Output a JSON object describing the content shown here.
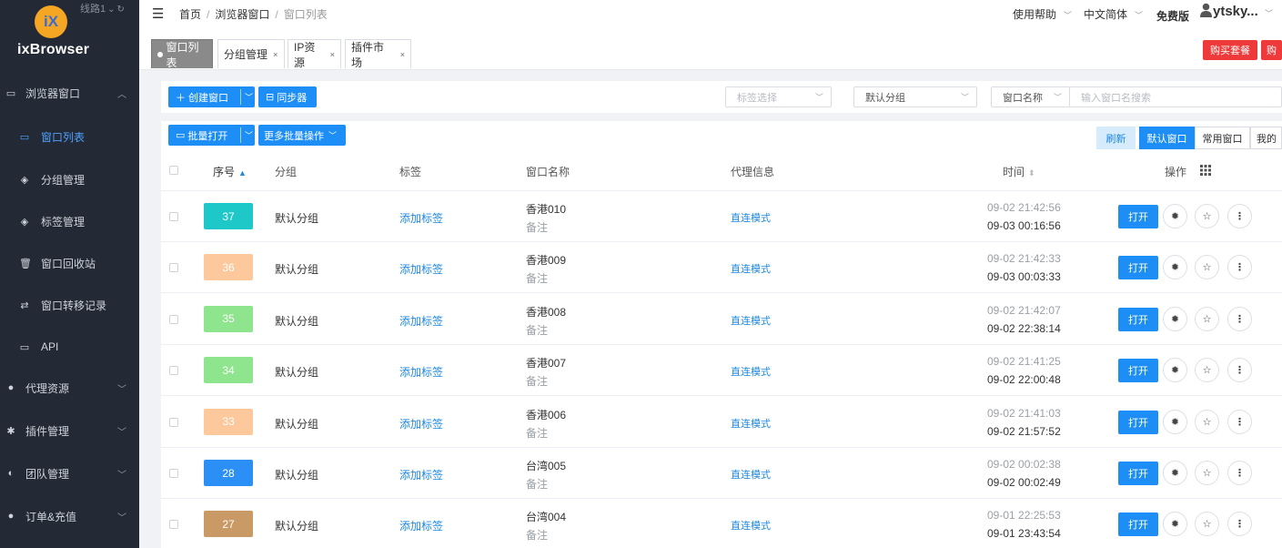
{
  "app": {
    "logo_mark": "iX",
    "logo_text": "ixBrowser",
    "route_label": "线路1"
  },
  "sidebar": {
    "items": [
      {
        "key": "browser",
        "label": "浏览器窗口",
        "icon": "browser-window-icon",
        "level": "top",
        "expanded": true
      },
      {
        "key": "window-list",
        "label": "窗口列表",
        "icon": "window-list-icon",
        "level": "sub",
        "active": true
      },
      {
        "key": "group-mgmt",
        "label": "分组管理",
        "icon": "layers-icon",
        "level": "sub"
      },
      {
        "key": "tag-mgmt",
        "label": "标签管理",
        "icon": "layers-icon",
        "level": "sub"
      },
      {
        "key": "recycle",
        "label": "窗口回收站",
        "icon": "trash-icon",
        "level": "sub"
      },
      {
        "key": "transfer",
        "label": "窗口转移记录",
        "icon": "transfer-icon",
        "level": "sub"
      },
      {
        "key": "api",
        "label": "API",
        "icon": "api-icon",
        "level": "sub"
      },
      {
        "key": "proxy",
        "label": "代理资源",
        "icon": "globe-icon",
        "level": "top"
      },
      {
        "key": "plugins",
        "label": "插件管理",
        "icon": "puzzle-icon",
        "level": "top"
      },
      {
        "key": "team",
        "label": "团队管理",
        "icon": "team-icon",
        "level": "top"
      },
      {
        "key": "orders",
        "label": "订单&充值",
        "icon": "info-icon",
        "level": "top"
      }
    ]
  },
  "header": {
    "breadcrumb": [
      "首页",
      "浏览器窗口",
      "窗口列表"
    ],
    "help": "使用帮助",
    "language": "中文简体",
    "plan": "免费版",
    "username": "ytsky..."
  },
  "tabs": [
    {
      "label": "窗口列表",
      "active": true,
      "closable": false
    },
    {
      "label": "分组管理",
      "closable": true
    },
    {
      "label": "IP资源",
      "closable": true
    },
    {
      "label": "插件市场",
      "closable": true
    }
  ],
  "buy": {
    "primary": "购买套餐",
    "secondary": "购"
  },
  "toolbar": {
    "create": "创建窗口",
    "sync": "同步器",
    "tag_placeholder": "标签选择",
    "group_value": "默认分组",
    "search_field": "窗口名称",
    "search_placeholder": "输入窗口名搜索",
    "batch_open": "批量打开",
    "more_batch": "更多批量操作",
    "refresh": "刷新",
    "seg_default": "默认窗口",
    "seg_common": "常用窗口",
    "seg_mine": "我的"
  },
  "table": {
    "headers": {
      "index": "序号",
      "group": "分组",
      "tags": "标签",
      "name": "窗口名称",
      "proxy": "代理信息",
      "time": "时间",
      "actions": "操作"
    },
    "rows": [
      {
        "num": "37",
        "color": "#1fc8c8",
        "group": "默认分组",
        "tag_link": "添加标签",
        "name": "香港010",
        "remark": "备注",
        "proxy": "直连模式",
        "time1": "09-02 21:42:56",
        "time2": "09-03 00:16:56",
        "open": "打开"
      },
      {
        "num": "36",
        "color": "#fcc89c",
        "group": "默认分组",
        "tag_link": "添加标签",
        "name": "香港009",
        "remark": "备注",
        "proxy": "直连模式",
        "time1": "09-02 21:42:33",
        "time2": "09-03 00:03:33",
        "open": "打开"
      },
      {
        "num": "35",
        "color": "#8ee58e",
        "group": "默认分组",
        "tag_link": "添加标签",
        "name": "香港008",
        "remark": "备注",
        "proxy": "直连模式",
        "time1": "09-02 21:42:07",
        "time2": "09-02 22:38:14",
        "open": "打开"
      },
      {
        "num": "34",
        "color": "#8ee58e",
        "group": "默认分组",
        "tag_link": "添加标签",
        "name": "香港007",
        "remark": "备注",
        "proxy": "直连模式",
        "time1": "09-02 21:41:25",
        "time2": "09-02 22:00:48",
        "open": "打开"
      },
      {
        "num": "33",
        "color": "#fcc89c",
        "group": "默认分组",
        "tag_link": "添加标签",
        "name": "香港006",
        "remark": "备注",
        "proxy": "直连模式",
        "time1": "09-02 21:41:03",
        "time2": "09-02 21:57:52",
        "open": "打开"
      },
      {
        "num": "28",
        "color": "#2b8ff5",
        "group": "默认分组",
        "tag_link": "添加标签",
        "name": "台湾005",
        "remark": "备注",
        "proxy": "直连模式",
        "time1": "09-02 00:02:38",
        "time2": "09-02 00:02:49",
        "open": "打开"
      },
      {
        "num": "27",
        "color": "#c99a66",
        "group": "默认分组",
        "tag_link": "添加标签",
        "name": "台湾004",
        "remark": "备注",
        "proxy": "直连模式",
        "time1": "09-01 22:25:53",
        "time2": "09-01 23:43:54",
        "open": "打开"
      }
    ]
  }
}
